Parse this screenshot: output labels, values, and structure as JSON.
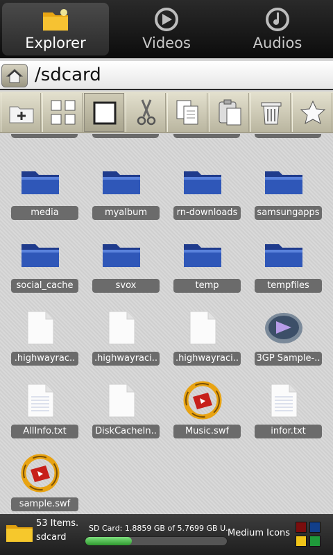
{
  "tabs": [
    {
      "label": "Explorer",
      "icon": "folder-icon",
      "active": true
    },
    {
      "label": "Videos",
      "icon": "video-icon",
      "active": false
    },
    {
      "label": "Audios",
      "icon": "audio-icon",
      "active": false
    }
  ],
  "pathbar": {
    "path": "/sdcard",
    "home_icon": "home-icon"
  },
  "toolbar": [
    {
      "name": "new-folder",
      "icon": "add-folder-icon"
    },
    {
      "name": "select-all",
      "icon": "grid-icon"
    },
    {
      "name": "select",
      "icon": "square-icon",
      "selected": true
    },
    {
      "name": "cut",
      "icon": "scissors-icon"
    },
    {
      "name": "copy",
      "icon": "copy-icon"
    },
    {
      "name": "paste",
      "icon": "paste-icon"
    },
    {
      "name": "delete",
      "icon": "trash-icon"
    },
    {
      "name": "favorite",
      "icon": "star-icon"
    }
  ],
  "items": [
    {
      "label": "media",
      "type": "folder"
    },
    {
      "label": "myalbum",
      "type": "folder"
    },
    {
      "label": "rn-downloads",
      "type": "folder"
    },
    {
      "label": "samsungapps",
      "type": "folder"
    },
    {
      "label": "social_cache",
      "type": "folder"
    },
    {
      "label": "svox",
      "type": "folder"
    },
    {
      "label": "temp",
      "type": "folder"
    },
    {
      "label": "tempfiles",
      "type": "folder"
    },
    {
      "label": ".highwayrac..",
      "type": "file"
    },
    {
      "label": ".highwayraci..",
      "type": "file"
    },
    {
      "label": ".highwayraci..",
      "type": "file"
    },
    {
      "label": "3GP Sample-..",
      "type": "video"
    },
    {
      "label": "AllInfo.txt",
      "type": "text"
    },
    {
      "label": "DiskCacheIn..",
      "type": "file"
    },
    {
      "label": "Music.swf",
      "type": "swf"
    },
    {
      "label": "infor.txt",
      "type": "text"
    },
    {
      "label": "sample.swf",
      "type": "swf"
    }
  ],
  "status": {
    "count": "53 Items.",
    "location": "sdcard",
    "storage": "SD Card: 1.8859 GB of 5.7699 GB U...",
    "used_fraction": 0.327,
    "view_mode": "Medium Icons",
    "theme_colors": [
      "#7a0d0d",
      "#123f8a",
      "#f0c419",
      "#1f9a3a"
    ]
  }
}
